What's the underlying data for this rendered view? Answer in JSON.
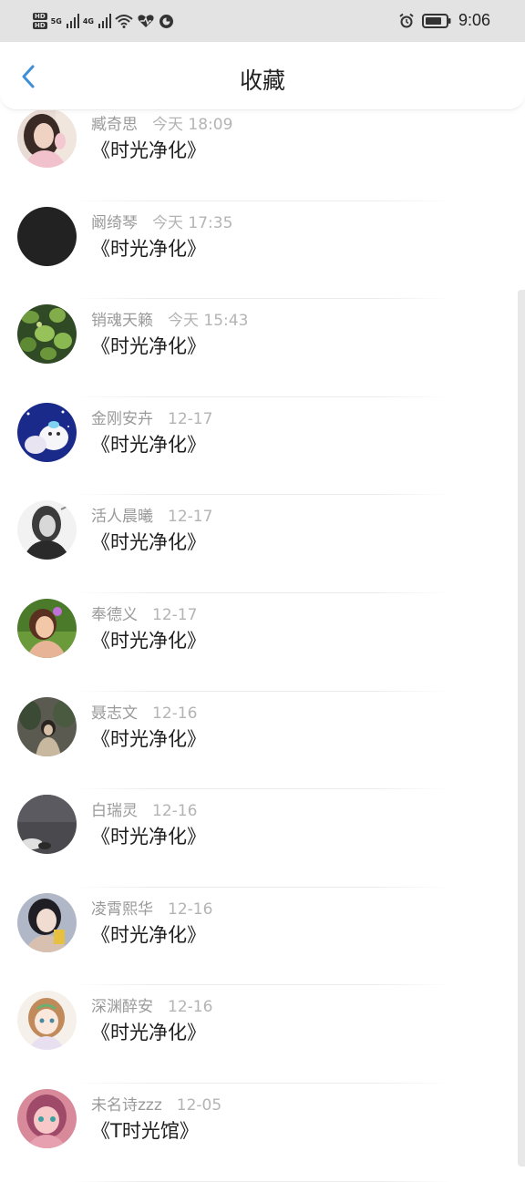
{
  "status_bar": {
    "left_labels": [
      "HD",
      "HD"
    ],
    "network_1": "5G",
    "network_2": "4G",
    "time": "9:06",
    "icons": [
      "signal-icon",
      "wifi-icon",
      "heart-rate-icon",
      "timer-icon",
      "alarm-icon",
      "battery-icon"
    ]
  },
  "header": {
    "title": "收藏",
    "back_icon": "chevron-left-icon",
    "accent_color": "#3d8fd6"
  },
  "favorites": [
    {
      "name": "臧奇思",
      "time": "今天 18:09",
      "title": "《时光净化》",
      "avatar": "photo-girl-pink"
    },
    {
      "name": "阚绮琴",
      "time": "今天 17:35",
      "title": "《时光净化》",
      "avatar": "dark-circle"
    },
    {
      "name": "销魂天籁",
      "time": "今天 15:43",
      "title": "《时光净化》",
      "avatar": "clover-leaves"
    },
    {
      "name": "金刚安卉",
      "time": "12-17",
      "title": "《时光净化》",
      "avatar": "cartoon-night"
    },
    {
      "name": "活人晨曦",
      "time": "12-17",
      "title": "《时光净化》",
      "avatar": "portrait-bw"
    },
    {
      "name": "奉德义",
      "time": "12-17",
      "title": "《时光净化》",
      "avatar": "girl-flower"
    },
    {
      "name": "聂志文",
      "time": "12-16",
      "title": "《时光净化》",
      "avatar": "girl-trees"
    },
    {
      "name": "白瑞灵",
      "time": "12-16",
      "title": "《时光净化》",
      "avatar": "dark-gray"
    },
    {
      "name": "凌霄熙华",
      "time": "12-16",
      "title": "《时光净化》",
      "avatar": "selfie-girl"
    },
    {
      "name": "深渊醉安",
      "time": "12-16",
      "title": "《时光净化》",
      "avatar": "anime-girl"
    },
    {
      "name": "未名诗zzz",
      "time": "12-05",
      "title": "《T时光馆》",
      "avatar": "anime-pink"
    }
  ]
}
